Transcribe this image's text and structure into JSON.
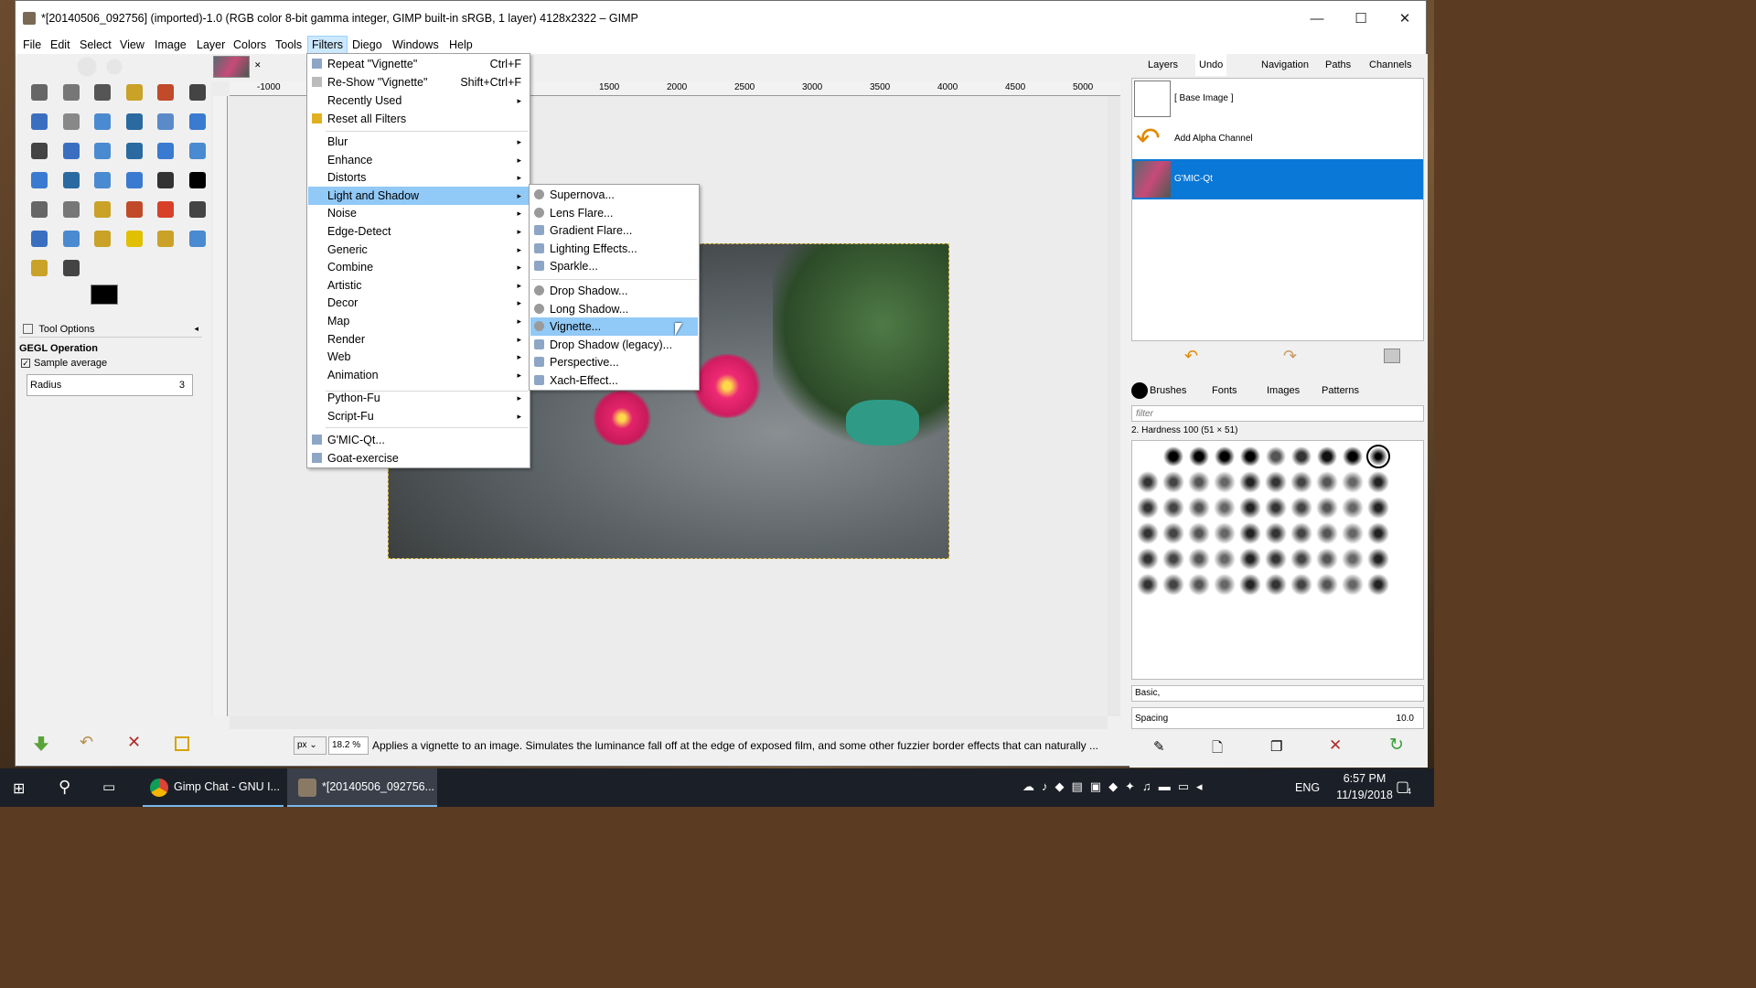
{
  "window": {
    "title": "*[20140506_092756] (imported)-1.0 (RGB color 8-bit gamma integer, GIMP built-in sRGB, 1 layer) 4128x2322 – GIMP"
  },
  "menubar": [
    "File",
    "Edit",
    "Select",
    "View",
    "Image",
    "Layer",
    "Colors",
    "Tools",
    "Filters",
    "Diego",
    "Windows",
    "Help"
  ],
  "filters_menu": {
    "top": [
      {
        "label": "Repeat \"Vignette\"",
        "shortcut": "Ctrl+F"
      },
      {
        "label": "Re-Show \"Vignette\"",
        "shortcut": "Shift+Ctrl+F"
      },
      {
        "label": "Recently Used",
        "shortcut": ""
      },
      {
        "label": "Reset all Filters",
        "shortcut": ""
      }
    ],
    "groups": [
      "Blur",
      "Enhance",
      "Distorts",
      "Light and Shadow",
      "Noise",
      "Edge-Detect",
      "Generic",
      "Combine",
      "Artistic",
      "Decor",
      "Map",
      "Render",
      "Web",
      "Animation"
    ],
    "scripts": [
      "Python-Fu",
      "Script-Fu"
    ],
    "plugins": [
      "G'MIC-Qt...",
      "Goat-exercise"
    ]
  },
  "light_shadow_menu": {
    "a": [
      "Supernova...",
      "Lens Flare...",
      "Gradient Flare...",
      "Lighting Effects...",
      "Sparkle..."
    ],
    "b": [
      "Drop Shadow...",
      "Long Shadow...",
      "Vignette...",
      "Drop Shadow (legacy)...",
      "Perspective...",
      "Xach-Effect..."
    ]
  },
  "tool_options": {
    "title": "Tool Options",
    "heading": "GEGL Operation",
    "sample": "Sample average",
    "radius_label": "Radius",
    "radius_value": "3"
  },
  "ruler": [
    "-1000",
    "1500",
    "2000",
    "2500",
    "3000",
    "3500",
    "4000",
    "4500",
    "5000"
  ],
  "dock_tabs_top": [
    "Layers",
    "Undo",
    "Navigation",
    "Paths",
    "Channels"
  ],
  "undo": [
    "[ Base Image ]",
    "Add Alpha Channel",
    "G'MIC-Qt"
  ],
  "dock_tabs_bottom": [
    "Brushes",
    "Fonts",
    "Images",
    "Patterns"
  ],
  "brushes": {
    "filter_placeholder": "filter",
    "current": "2. Hardness 100 (51 × 51)",
    "preset": "Basic,",
    "spacing_label": "Spacing",
    "spacing_value": "10.0"
  },
  "status": {
    "unit": "px",
    "zoom": "18.2 %",
    "message": "Applies a vignette to an image. Simulates the luminance fall off at the edge of exposed film, and some other fuzzier border effects that can naturally ..."
  },
  "taskbar": {
    "app1": "Gimp Chat - GNU I...",
    "app2": "*[20140506_092756...",
    "lang": "ENG",
    "time": "6:57 PM",
    "date": "11/19/2018",
    "notif": "4"
  },
  "colors": {
    "highlight": "#91c9f7",
    "selected_row": "#0a78d7",
    "taskbar": "#1b1f27"
  }
}
